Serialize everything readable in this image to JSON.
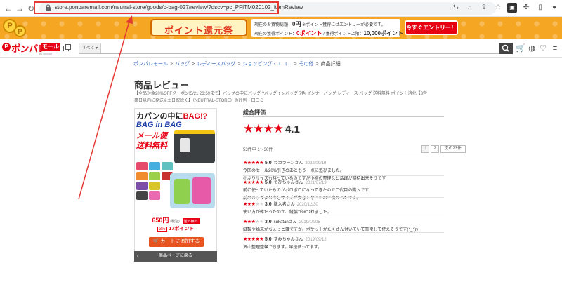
{
  "browser": {
    "url": "store.ponparemall.com/neutral-store/goods/c-bag-027/review/?dscv=pc_PFITM020102_itemReview",
    "back_glyph": "←",
    "forward_glyph": "→",
    "reload_glyph": "↻"
  },
  "banner": {
    "title": "ポイント還元祭",
    "coin_letter": "P",
    "row1_label": "現在のお買物総額：",
    "row1_value": "0円",
    "row1_note": "※ポイント獲得にはエントリーが必要です。",
    "row2_label": "現在の獲得ポイント：",
    "row2_value": "0ポイント",
    "row2_sep": "/ 獲得ポイント上限：",
    "row2_max": "10,000ポイント",
    "entry_button": "今すぐエントリー！"
  },
  "site": {
    "logo_letter": "P",
    "logo_text": "ポンパレ",
    "logo_mall": "モール",
    "logo_sub": "by Recruit",
    "search_category": "すべて"
  },
  "breadcrumb": [
    "ポンパレモール",
    "バッグ",
    "レディースバッグ",
    "ショッピング・エコ…",
    "その他",
    "商品詳細"
  ],
  "page": {
    "title": "商品レビュー",
    "description": "【全品対象20%OFFクーポン!5/21 23:59まで】バッグの中にバッグ ?バッグインバッグ 7色 インナーバッグ レディース バッグ 送料無料 ポイント消化【3営業日以内に発送※土日祝除く】（NEUTRAL-STORE）の評判・口コミ"
  },
  "product": {
    "img_line1": "カバンの中に",
    "img_line1b": "BAG!?",
    "img_line2": "BAG in BAG",
    "img_line3": "メール便",
    "img_line4": "送料無料",
    "price": "650円",
    "tax": "(税込)",
    "shipping_badge": "送料無料",
    "point_rate": "3%",
    "points": "17ポイント",
    "cart_button": "カートに追加する",
    "back_button": "商品ページに戻る",
    "back_glyph": "‹"
  },
  "reviews": {
    "heading": "総合評価",
    "overall_score": "4.1",
    "overall_stars": 4,
    "count_text": "53件中 1〜30件",
    "pager": {
      "prev": "1",
      "current": "2",
      "next": "次の23件"
    },
    "items": [
      {
        "stars": 5,
        "score": "5.0",
        "name": "わカラーンさん",
        "date": "2022/09/19",
        "lines": [
          "今回のセール20%引きのあともう一点に追びました。",
          "小ぶりサイズも持っているのですが小物の整理など活躍が期待出来そうです"
        ]
      },
      {
        "stars": 5,
        "score": "5.0",
        "name": "でびちゃんさん",
        "date": "2021/07/19",
        "lines": [
          "前に使っていたものがボロボロになってきたので二代目の購入です",
          "前のバッグより少しサイズが大きくなったので良かったです。"
        ]
      },
      {
        "stars": 3,
        "score": "3.0",
        "name": "購入者さん",
        "date": "2020/12/30",
        "lines": [
          "使い方が雑だったのか、縫製がほつれました。"
        ]
      },
      {
        "stars": 3,
        "score": "3.0",
        "name": "sukatanさん",
        "date": "2019/10/05",
        "lines": [
          "縫製や始末がちょっと雑ですが、ポケットがたくさん付いていて重宝して使えそうです(^_^)v"
        ]
      },
      {
        "stars": 5,
        "score": "5.0",
        "name": "すみちゃんさん",
        "date": "2019/09/12",
        "lines": [
          "沢山整理整頓できます。早速使ってます。"
        ]
      }
    ]
  },
  "colors": {
    "accent": "#e60012",
    "banner": "#f5a623",
    "link": "#3366bb"
  }
}
